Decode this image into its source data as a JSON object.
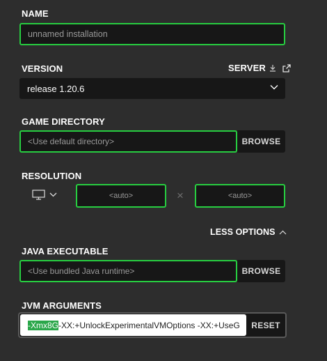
{
  "name": {
    "label": "NAME",
    "placeholder": "unnamed installation"
  },
  "version": {
    "label": "VERSION",
    "server_link": "SERVER",
    "selected": "release 1.20.6"
  },
  "game_directory": {
    "label": "GAME DIRECTORY",
    "placeholder": "<Use default directory>",
    "browse_label": "BROWSE"
  },
  "resolution": {
    "label": "RESOLUTION",
    "width_placeholder": "<auto>",
    "height_placeholder": "<auto>",
    "separator": "×"
  },
  "options_toggle": {
    "label": "LESS OPTIONS"
  },
  "java_executable": {
    "label": "JAVA EXECUTABLE",
    "placeholder": "<Use bundled Java runtime>",
    "browse_label": "BROWSE"
  },
  "jvm_arguments": {
    "label": "JVM ARGUMENTS",
    "selected_text": "-Xmx8G",
    "rest_text": " -XX:+UnlockExperimentalVMOptions -XX:+UseG",
    "reset_label": "RESET"
  },
  "colors": {
    "background": "#2d2d2d",
    "field": "#171717",
    "accent_green": "#27ce40",
    "selection": "#2aa74a"
  },
  "icons": [
    "download-icon",
    "external-link-icon",
    "chevron-down-icon",
    "monitor-icon",
    "chevron-up-icon"
  ]
}
